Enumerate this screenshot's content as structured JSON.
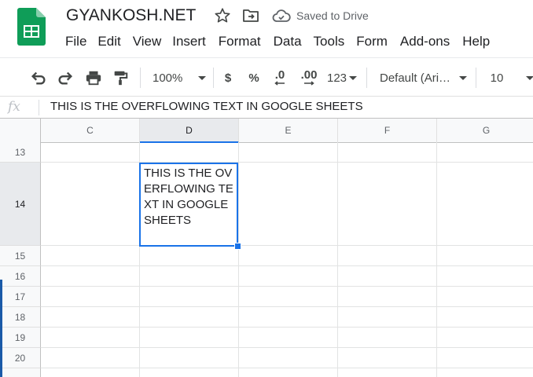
{
  "header": {
    "title": "GYANKOSH.NET",
    "save_status": "Saved to Drive",
    "icons": [
      "sheets-logo-icon",
      "star-icon",
      "move-to-folder-icon",
      "cloud-saved-icon"
    ]
  },
  "menu": {
    "items": [
      "File",
      "Edit",
      "View",
      "Insert",
      "Format",
      "Data",
      "Tools",
      "Form",
      "Add-ons",
      "Help"
    ]
  },
  "toolbar": {
    "zoom": "100%",
    "currency_label": "$",
    "percent_label": "%",
    "decrease_decimal_label": ".0",
    "increase_decimal_label": ".00",
    "more_formats_label": "123",
    "font_family": "Default (Ari…",
    "font_size": "10",
    "icons": [
      "undo-icon",
      "redo-icon",
      "print-icon",
      "paint-format-icon"
    ]
  },
  "formula_bar": {
    "fx_label": "fx",
    "value": "THIS IS THE OVERFLOWING TEXT IN GOOGLE SHEETS"
  },
  "grid": {
    "columns": [
      "C",
      "D",
      "E",
      "F",
      "G"
    ],
    "selected_column": "D",
    "rows": [
      "13",
      "14",
      "15",
      "16",
      "17",
      "18",
      "19",
      "20"
    ],
    "selected_row": "14",
    "active_cell": {
      "ref": "D14",
      "value": "THIS IS THE OVERFLOWING TEXT IN GOOGLE SHEETS"
    }
  },
  "colors": {
    "accent": "#1a73e8",
    "sheets_green": "#0f9d58",
    "header_bg": "#f8f9fa",
    "selected_header_bg": "#e8eaed"
  }
}
